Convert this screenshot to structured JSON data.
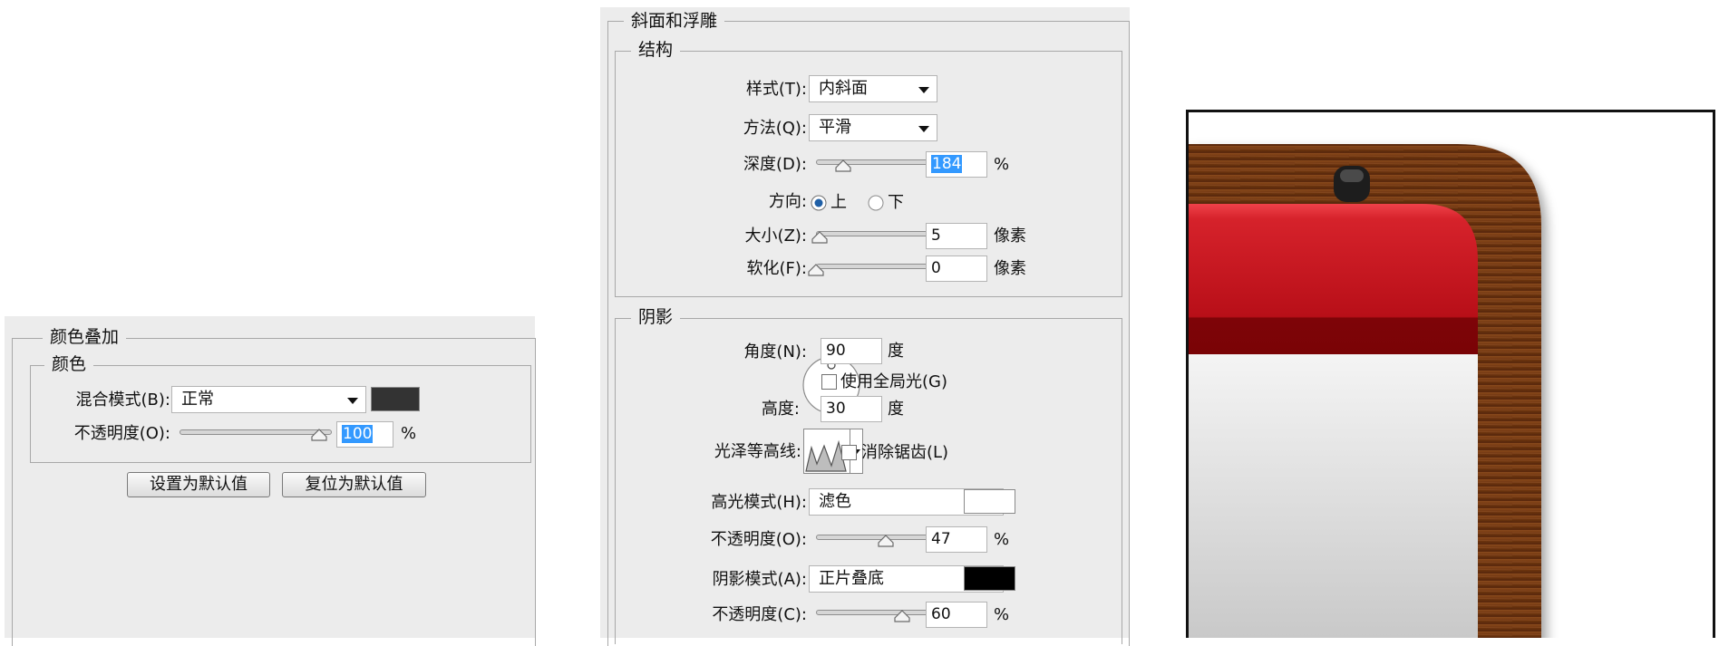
{
  "color_overlay": {
    "title": "颜色叠加",
    "group_title": "颜色",
    "blend_mode_label": "混合模式(B):",
    "blend_mode_value": "正常",
    "swatch_color": "#333333",
    "opacity_label": "不透明度(O):",
    "opacity_value": "100",
    "opacity_unit": "%",
    "opacity_fraction": 1.0,
    "set_default_button": "设置为默认值",
    "reset_default_button": "复位为默认值"
  },
  "bevel_emboss": {
    "title": "斜面和浮雕",
    "structure": {
      "title": "结构",
      "style_label": "样式(T):",
      "style_value": "内斜面",
      "method_label": "方法(Q):",
      "method_value": "平滑",
      "depth_label": "深度(D):",
      "depth_value": "184",
      "depth_unit": "%",
      "depth_fraction": 0.18,
      "direction_label": "方向:",
      "direction_up": "上",
      "direction_down": "下",
      "direction_selected": "up",
      "size_label": "大小(Z):",
      "size_value": "5",
      "size_unit": "像素",
      "size_fraction": 0.02,
      "soften_label": "软化(F):",
      "soften_value": "0",
      "soften_unit": "像素",
      "soften_fraction": 0.0
    },
    "shading": {
      "title": "阴影",
      "angle_label": "角度(N):",
      "angle_value": "90",
      "angle_unit": "度",
      "global_light_label": "使用全局光(G)",
      "global_light_checked": false,
      "altitude_label": "高度:",
      "altitude_value": "30",
      "altitude_unit": "度",
      "gloss_contour_label": "光泽等高线:",
      "anti_alias_label": "消除锯齿(L)",
      "anti_alias_checked": false,
      "highlight_mode_label": "高光模式(H):",
      "highlight_mode_value": "滤色",
      "highlight_color": "#ffffff",
      "highlight_opacity_label": "不透明度(O):",
      "highlight_opacity_value": "47",
      "highlight_opacity_unit": "%",
      "highlight_opacity_fraction": 0.47,
      "shadow_mode_label": "阴影模式(A):",
      "shadow_mode_value": "正片叠底",
      "shadow_color": "#000000",
      "shadow_opacity_label": "不透明度(C):",
      "shadow_opacity_value": "60",
      "shadow_opacity_unit": "%",
      "shadow_opacity_fraction": 0.6
    }
  },
  "preview": {
    "wood_color": "#7a3c12",
    "red_color": "#d01e26",
    "knob_color": "#222222"
  }
}
